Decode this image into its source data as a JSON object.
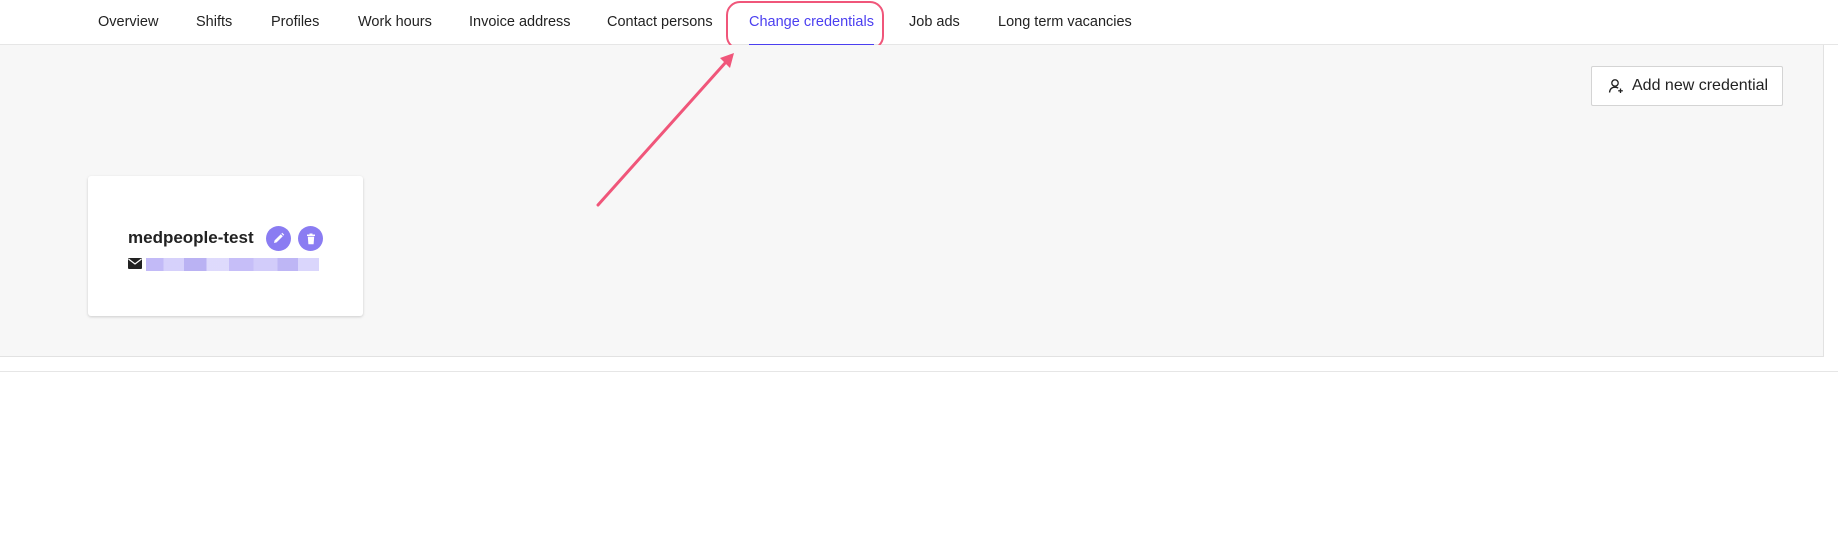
{
  "tabs": [
    {
      "label": "Overview"
    },
    {
      "label": "Shifts"
    },
    {
      "label": "Profiles"
    },
    {
      "label": "Work hours"
    },
    {
      "label": "Invoice address"
    },
    {
      "label": "Contact persons"
    },
    {
      "label": "Change credentials",
      "active": true
    },
    {
      "label": "Job ads"
    },
    {
      "label": "Long term vacancies"
    }
  ],
  "toolbar": {
    "add_label": "Add new credential",
    "add_icon": "add-user-icon"
  },
  "credential": {
    "name": "medpeople-test",
    "email_icon": "envelope-icon",
    "edit_icon": "pencil-icon",
    "delete_icon": "trash-icon"
  },
  "colors": {
    "accent": "#4b3ff0",
    "action_circle": "#8a7cf2",
    "annotation": "#f0567a",
    "panel_bg": "#f7f7f7"
  }
}
